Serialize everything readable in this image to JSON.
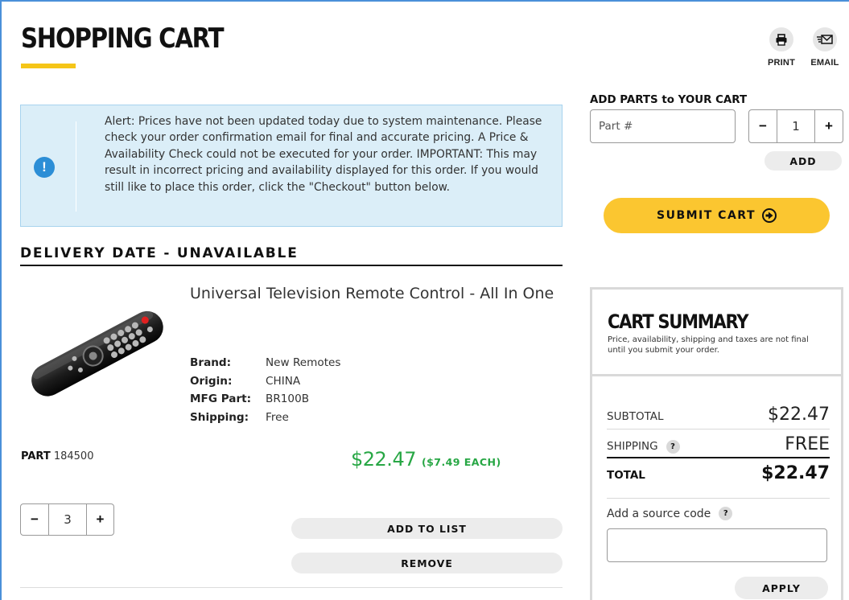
{
  "page": {
    "title": "SHOPPING CART",
    "print_label": "PRINT",
    "email_label": "EMAIL",
    "print_icon": "printer-icon",
    "email_icon": "envelope-icon"
  },
  "alert": {
    "icon": "exclamation-icon",
    "text": "Alert: Prices have not been updated today due to system maintenance. Please check your order confirmation email for final and accurate pricing. A Price & Availability Check could not be executed for your order. IMPORTANT: This may result in incorrect pricing and availability displayed for this order. If you would still like to place this order, click the \"Checkout\" button below."
  },
  "delivery": {
    "heading": "DELIVERY DATE - UNAVAILABLE"
  },
  "item": {
    "name": "Universal Television Remote Control - All In One",
    "brand_label": "Brand:",
    "brand": "New Remotes",
    "origin_label": "Origin:",
    "origin": "CHINA",
    "mfg_label": "MFG Part:",
    "mfg_part": "BR100B",
    "shipping_label": "Shipping:",
    "shipping": "Free",
    "part_label": "PART",
    "part_number": "184500",
    "price": "$22.47",
    "price_each": "($7.49  EACH)",
    "quantity": "3",
    "minus": "−",
    "plus": "+",
    "add_to_list": "ADD TO LIST",
    "remove": "REMOVE"
  },
  "add_parts": {
    "label": "ADD PARTS to YOUR CART",
    "placeholder": "Part #",
    "quantity": "1",
    "minus": "−",
    "plus": "+",
    "add": "ADD"
  },
  "submit": {
    "label": "SUBMIT CART",
    "icon": "arrow-circle-right-icon"
  },
  "summary": {
    "title": "CART SUMMARY",
    "note": "Price, availability, shipping and taxes are not final until you submit your order.",
    "subtotal_label": "SUBTOTAL",
    "subtotal": "$22.47",
    "shipping_label": "SHIPPING",
    "shipping": "FREE",
    "total_label": "TOTAL",
    "total": "$22.47",
    "help": "?",
    "source_label": "Add a source code",
    "apply": "APPLY"
  },
  "colors": {
    "accent_yellow": "#fbc630",
    "price_green": "#28a745",
    "alert_bg": "#dbeef8",
    "alert_icon": "#2c8ed6"
  }
}
